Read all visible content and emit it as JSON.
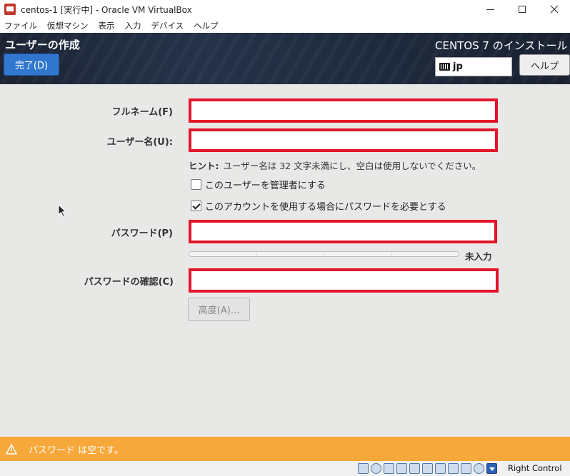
{
  "window": {
    "title": "centos-1 [実行中] - Oracle VM VirtualBox"
  },
  "menu": {
    "items": [
      "ファイル",
      "仮想マシン",
      "表示",
      "入力",
      "デバイス",
      "ヘルプ"
    ]
  },
  "header": {
    "page_title": "ユーザーの作成",
    "done_label": "完了(D)",
    "product_title": "CENTOS 7 のインストール",
    "keyboard_layout": "jp",
    "help_label": "ヘルプ"
  },
  "form": {
    "fullname_label": "フルネーム(F)",
    "fullname_value": "",
    "username_label": "ユーザー名(U):",
    "username_value": "",
    "hint_prefix": "ヒント:",
    "hint_text": "ユーザー名は 32 文字未満にし、空白は使用しないでください。",
    "admin_checkbox_label": "このユーザーを管理者にする",
    "admin_checked": false,
    "require_password_label": "このアカウントを使用する場合にパスワードを必要とする",
    "require_password_checked": true,
    "password_label": "パスワード(P)",
    "password_value": "",
    "strength_label": "未入力",
    "confirm_label": "パスワードの確認(C)",
    "confirm_value": "",
    "advanced_label": "高度(A)..."
  },
  "warning": {
    "text": "パスワード は空です。"
  },
  "statusbar": {
    "host_key": "Right Control"
  },
  "colors": {
    "done_button": "#3277cf",
    "field_highlight": "#e3152a",
    "warning_bar": "#f7a83a",
    "content_bg": "#e8e8e7"
  }
}
